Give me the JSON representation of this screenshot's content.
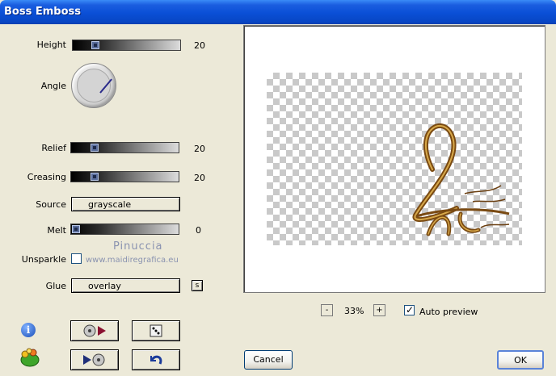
{
  "window": {
    "title": "Boss Emboss"
  },
  "controls": {
    "height": {
      "label": "Height",
      "value": "20"
    },
    "angle": {
      "label": "Angle"
    },
    "relief": {
      "label": "Relief",
      "value": "20"
    },
    "creasing": {
      "label": "Creasing",
      "value": "20"
    },
    "source": {
      "label": "Source",
      "value": "grayscale"
    },
    "melt": {
      "label": "Melt",
      "value": "0"
    },
    "unsparkle": {
      "label": "Unsparkle",
      "checked": false
    },
    "glue": {
      "label": "Glue",
      "value": "overlay",
      "side_button": "s"
    }
  },
  "watermark": {
    "name": "Pinuccia",
    "url": "www.maidiregrafica.eu"
  },
  "preview": {
    "zoom_minus": "-",
    "zoom_level": "33%",
    "zoom_plus": "+",
    "auto_preview_label": "Auto preview",
    "auto_preview_checked": true
  },
  "buttons": {
    "cancel": "Cancel",
    "ok": "OK"
  },
  "icons": {
    "info": "info-icon",
    "app": "frog-icon",
    "save_preset": "disk-forward-icon",
    "random": "dice-icon",
    "load_preset": "play-disk-icon",
    "reset": "undo-arrow-icon"
  },
  "colors": {
    "titlebar": "#0a4fd6",
    "dialog_bg": "#ece9d8",
    "slider_thumb": "#5b6e9c"
  }
}
